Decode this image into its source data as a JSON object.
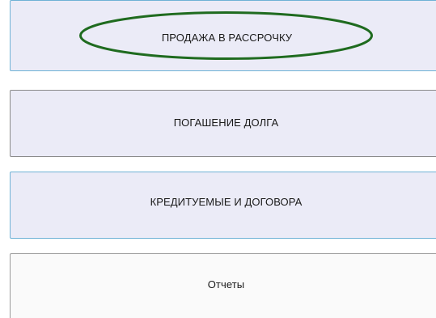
{
  "menu": {
    "items": [
      {
        "label": "ПРОДАЖА В РАССРОЧКУ"
      },
      {
        "label": "ПОГАШЕНИЕ ДОЛГА"
      },
      {
        "label": "КРЕДИТУЕМЫЕ И ДОГОВОРА"
      },
      {
        "label": "Отчеты"
      }
    ]
  },
  "colors": {
    "button_bg": "#ebebf7",
    "button_border_active": "#6fb2d6",
    "highlight_ellipse": "#1f6b1f"
  }
}
